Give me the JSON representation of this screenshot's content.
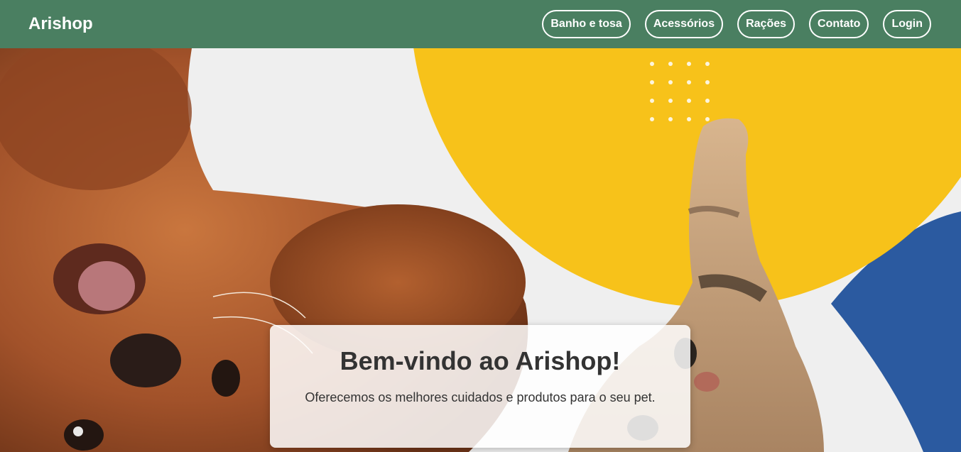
{
  "header": {
    "brand": "Arishop",
    "nav": [
      {
        "label": "Banho e tosa"
      },
      {
        "label": "Acessórios"
      },
      {
        "label": "Rações"
      },
      {
        "label": "Contato"
      },
      {
        "label": "Login"
      }
    ]
  },
  "hero": {
    "image_description_icon": "pets-hero-image",
    "title": "Bem-vindo ao Arishop!",
    "subtitle": "Oferecemos os melhores cuidados e produtos para o seu pet."
  },
  "colors": {
    "header_bg": "#4a7f61",
    "yellow_circle": "#f7c21a",
    "blue_shape": "#2b5aa0",
    "dog_fur": "#a8552a"
  }
}
